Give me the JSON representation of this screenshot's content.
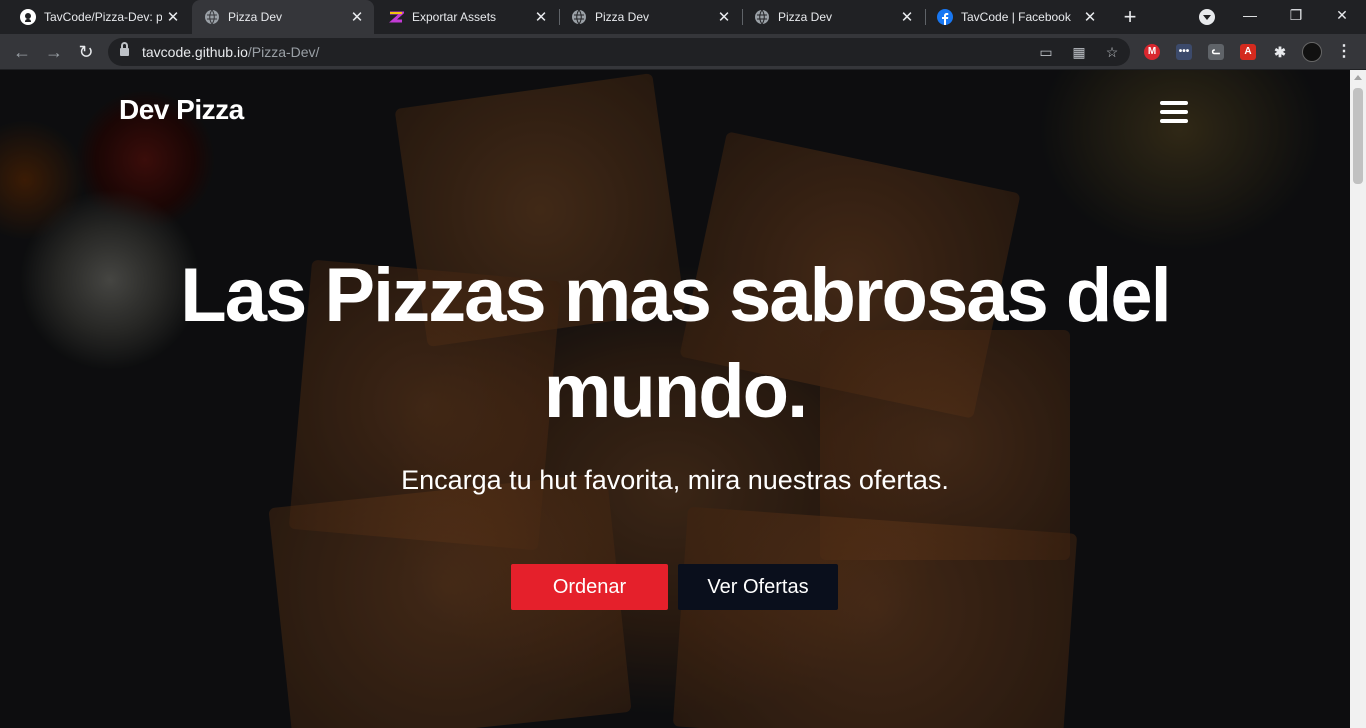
{
  "tabs": [
    {
      "title": "TavCode/Pizza-Dev: pa",
      "icon": "github-icon",
      "active": false
    },
    {
      "title": "Pizza Dev",
      "icon": "globe-icon",
      "active": true
    },
    {
      "title": "Exportar Assets",
      "icon": "zeplin-icon",
      "active": false
    },
    {
      "title": "Pizza Dev",
      "icon": "globe-icon",
      "active": false
    },
    {
      "title": "Pizza Dev",
      "icon": "globe-icon",
      "active": false
    },
    {
      "title": "TavCode | Facebook",
      "icon": "facebook-icon",
      "active": false
    }
  ],
  "address_bar": {
    "host": "tavcode.github.io",
    "path": "/Pizza-Dev/"
  },
  "page": {
    "brand": "Dev Pizza",
    "hero_title": "Las Pizzas mas sabrosas del mundo.",
    "hero_subtitle": "Encarga tu hut favorita, mira nuestras ofertas.",
    "order_button": "Ordenar",
    "offers_button": "Ver Ofertas"
  },
  "colors": {
    "order_button": "#e5202b",
    "offers_button": "#0a0f1c",
    "browser_dark": "#202124",
    "toolbar": "#35363a"
  }
}
